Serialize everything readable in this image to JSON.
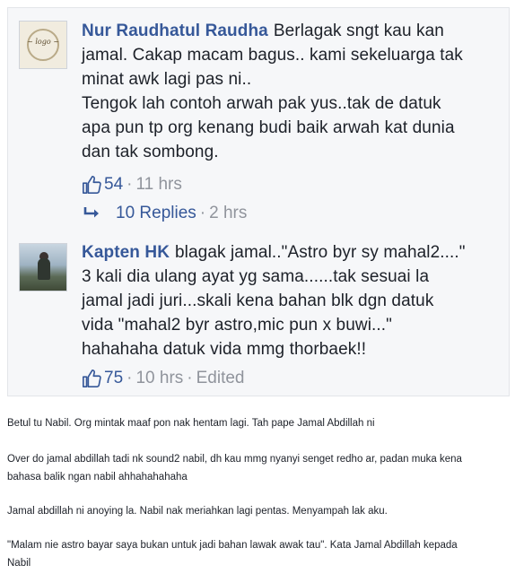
{
  "comments": [
    {
      "author": "Nur Raudhatul Raudha",
      "text": "Berlagak sngt kau kan\njamal. Cakap macam bagus.. kami sekeluarga tak\nminat awk lagi pas ni..\nTengok lah contoh arwah pak yus..tak de datuk\napa pun tp org kenang budi baik arwah kat dunia\ndan tak sombong.",
      "likes": "54",
      "separator": "·",
      "time": "11 hrs",
      "replies_label": "10 Replies",
      "replies_time": "2 hrs",
      "avatar_icon": "floral-logo-avatar"
    },
    {
      "author": "Kapten HK",
      "text": "blagak jamal..\"Astro byr sy mahal2....\"\n3 kali dia ulang ayat yg sama......tak sesuai la\njamal jadi juri...skali kena bahan blk dgn datuk\nvida \"mahal2 byr astro,mic pun x buwi...\"\nhahahaha datuk vida mmg thorbaek!!",
      "likes": "75",
      "separator": "·",
      "time": "10 hrs",
      "edited": "Edited",
      "avatar_icon": "person-landscape-avatar"
    }
  ],
  "article": {
    "paragraphs": [
      "Betul tu Nabil. Org mintak maaf pon nak hentam lagi. Tah pape Jamal Abdillah ni",
      "Over do jamal abdillah tadi nk sound2 nabil, dh kau mmg nyanyi senget redho ar, padan muka kena",
      "bahasa balik ngan nabil ahhahahahaha",
      "Jamal abdillah ni anoying la. Nabil nak meriahkan lagi pentas. Menyampah lak aku.",
      "\"Malam nie astro bayar saya bukan untuk jadi bahan lawak awak tau\". Kata Jamal Abdillah kepada",
      "Nabil"
    ]
  },
  "colors": {
    "name_blue": "#365899",
    "meta_gray": "#90949c",
    "text": "#1d2129",
    "panel_bg": "#f6f7f9"
  },
  "icons": {
    "like": "thumbs-up-icon",
    "reply": "reply-arrow-icon"
  }
}
